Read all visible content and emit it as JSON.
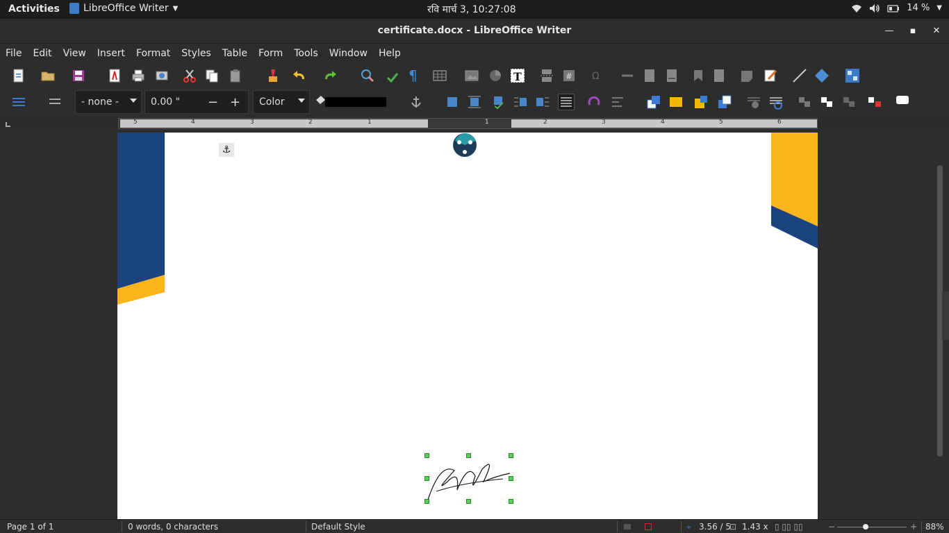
{
  "topbar": {
    "activities": "Activities",
    "app_name": "LibreOffice Writer",
    "clock": "रवि मार्च   3, 10:27:08",
    "battery": "14 %"
  },
  "window": {
    "title": "certificate.docx - LibreOffice Writer"
  },
  "menu": [
    "File",
    "Edit",
    "View",
    "Insert",
    "Format",
    "Styles",
    "Table",
    "Form",
    "Tools",
    "Window",
    "Help"
  ],
  "frame_toolbar": {
    "border_style": "- none -",
    "width_value": "0.00 \"",
    "color_label": "Color",
    "shadow_color": "#000000"
  },
  "ruler": {
    "left_ticks": [
      "5",
      "4",
      "3",
      "2",
      "1"
    ],
    "right_ticks": [
      "1",
      "2",
      "3",
      "4",
      "5",
      "6"
    ]
  },
  "colors": {
    "navy": "#1b437f",
    "gold": "#fbb41a",
    "teal": "#2a9aa4"
  },
  "status": {
    "page": "Page 1 of 1",
    "words": "0 words, 0 characters",
    "style": "Default Style",
    "position": "3.56 / 5",
    "size": "1.43 x",
    "zoom": "88%"
  }
}
